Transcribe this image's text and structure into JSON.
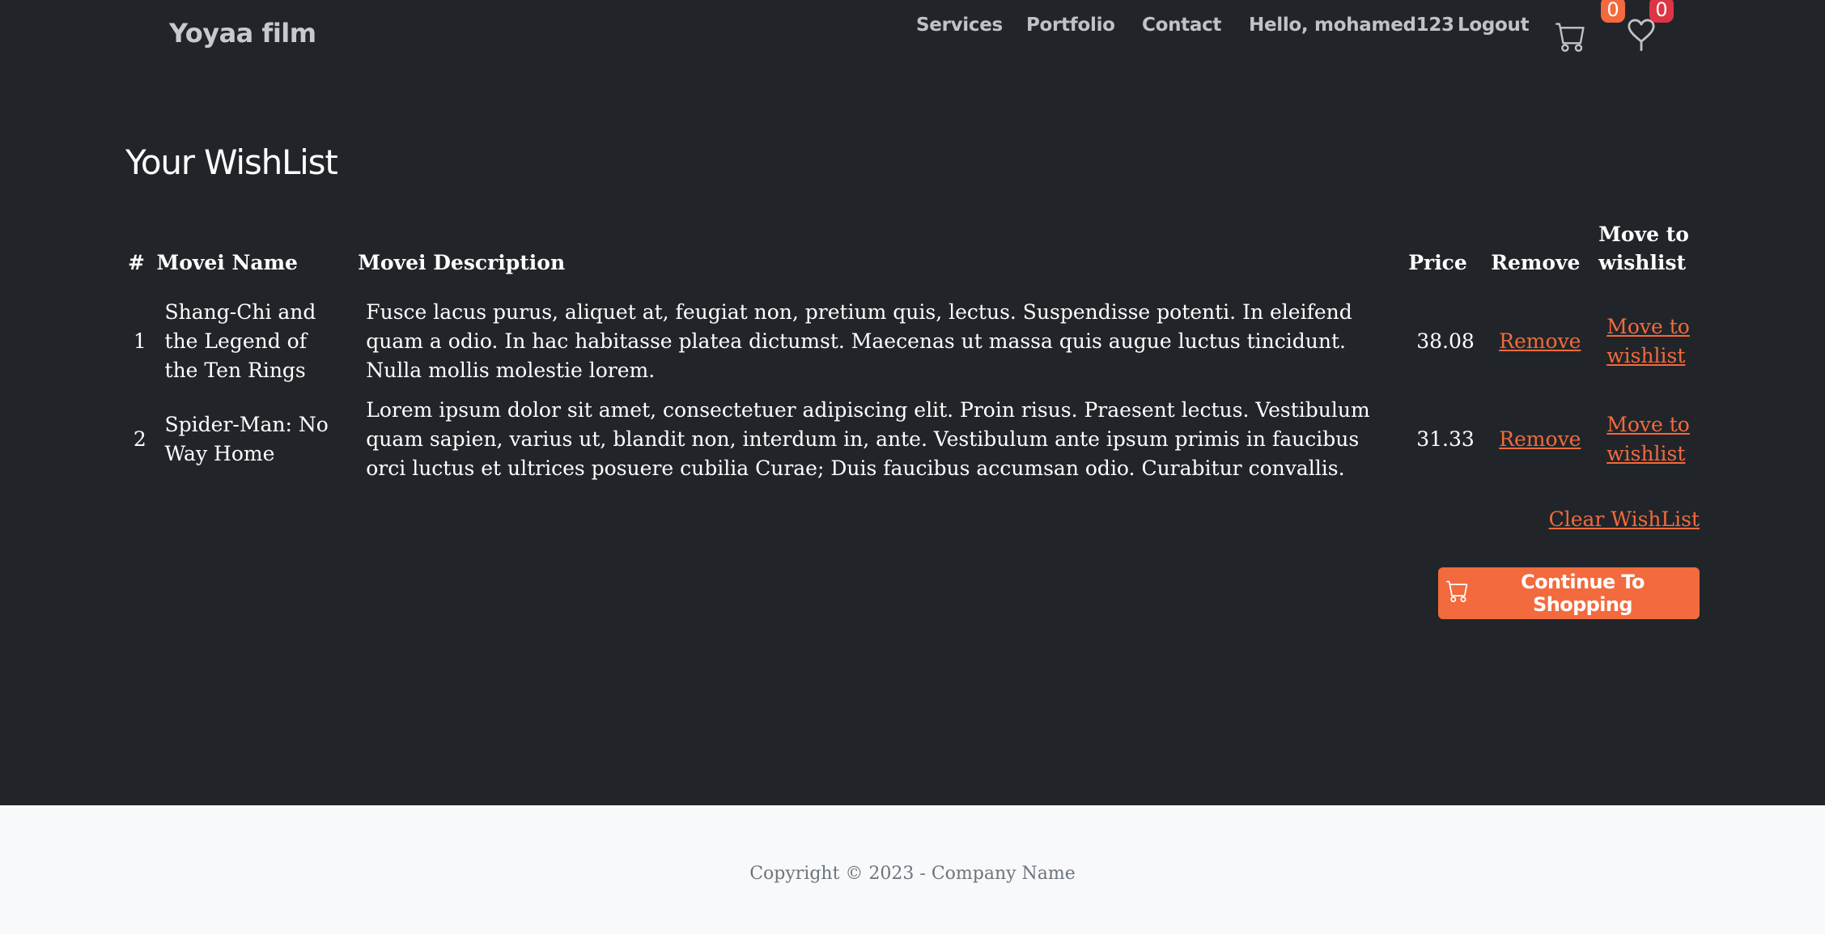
{
  "header": {
    "brand": "Yoyaa film",
    "nav": [
      "Services",
      "Portfolio",
      "Contact",
      "Hello, mohamed123",
      "Logout"
    ],
    "cart_count": "0",
    "wishlist_count": "0",
    "icons": {
      "cart": "cart-icon",
      "wishlist": "heart-icon"
    },
    "badge_colors": {
      "cart": "#f26a3d",
      "wishlist": "#dc3545"
    }
  },
  "main": {
    "title": "Your WishList",
    "columns": [
      "#",
      "Movei Name",
      "Movei Description",
      "Price",
      "Remove",
      "Move to wishlist"
    ],
    "rows": [
      {
        "num": "1",
        "name": "Shang-Chi and the Legend of the Ten Rings",
        "description": "Fusce lacus purus, aliquet at, feugiat non, pretium quis, lectus. Suspendisse potenti. In eleifend quam a odio. In hac habitasse platea dictumst. Maecenas ut massa quis augue luctus tincidunt. Nulla mollis molestie lorem.",
        "price": "38.08",
        "remove_label": "Remove",
        "move_label": "Move to wishlist"
      },
      {
        "num": "2",
        "name": "Spider-Man: No Way Home",
        "description": "Lorem ipsum dolor sit amet, consectetuer adipiscing elit. Proin risus. Praesent lectus. Vestibulum quam sapien, varius ut, blandit non, interdum in, ante. Vestibulum ante ipsum primis in faucibus orci luctus et ultrices posuere cubilia Curae; Duis faucibus accumsan odio. Curabitur convallis.",
        "price": "31.33",
        "remove_label": "Remove",
        "move_label": "Move to wishlist"
      }
    ],
    "clear_label": "Clear WishList",
    "continue_label": "Continue To Shopping",
    "accent_color": "#f26a3d"
  },
  "footer": {
    "copyright": "Copyright © 2023 - Company Name"
  }
}
